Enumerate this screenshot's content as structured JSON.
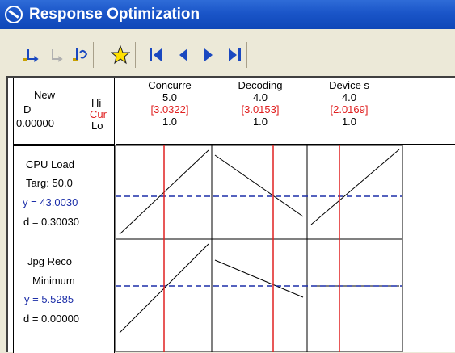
{
  "window": {
    "title": "Response Optimization"
  },
  "toolbar": {
    "buttons": [
      {
        "name": "factor-setup-icon",
        "glyph": "↴"
      },
      {
        "name": "disabled-step-icon",
        "glyph": "↴"
      },
      {
        "name": "sensitivity-icon",
        "glyph": "↶"
      },
      {
        "name": "star-icon",
        "glyph": "★"
      },
      {
        "name": "first-icon",
        "glyph": "|◀"
      },
      {
        "name": "previous-icon",
        "glyph": "◀"
      },
      {
        "name": "next-icon",
        "glyph": "▶"
      },
      {
        "name": "last-icon",
        "glyph": "▶|"
      }
    ]
  },
  "optimal": {
    "new_label": "New",
    "d_label": "D",
    "d_value": "0.00000",
    "hi_label": "Hi",
    "cur_label": "Cur",
    "lo_label": "Lo"
  },
  "factors": [
    {
      "name": "Concurre",
      "hi": "5.0",
      "cur": "[3.0322]",
      "lo": "1.0"
    },
    {
      "name": "Decoding",
      "hi": "4.0",
      "cur": "[3.0153]",
      "lo": "1.0"
    },
    {
      "name": "Device s",
      "hi": "4.0",
      "cur": "[2.0169]",
      "lo": "1.0"
    }
  ],
  "responses": [
    {
      "name": "CPU Load",
      "goal": "Targ: 50.0",
      "y": "y = 43.0030",
      "d": "d = 0.30030"
    },
    {
      "name": "Jpg Reco",
      "goal": "Minimum",
      "y": "y = 5.5285",
      "d": "d = 0.00000"
    }
  ],
  "colors": {
    "current_line": "#e02020",
    "target_line": "#1c2ea8"
  }
}
